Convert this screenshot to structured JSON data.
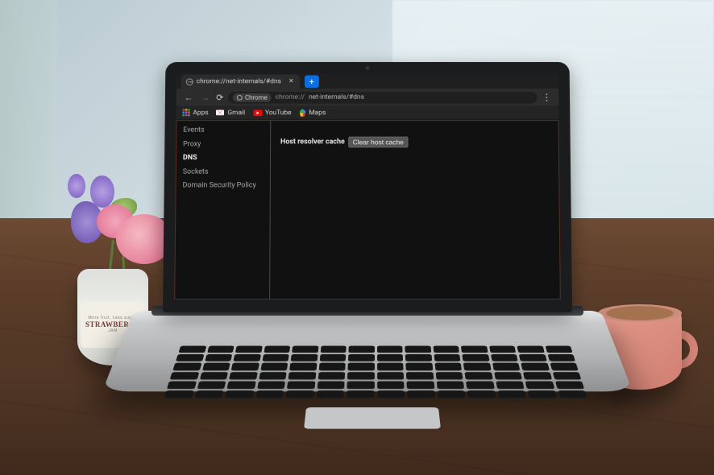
{
  "browser": {
    "tab": {
      "title": "chrome://net-internals/#dns"
    },
    "address": {
      "chip": "Chrome",
      "path_dim": "chrome://",
      "path": "net-internals/#dns"
    },
    "bookmarks": {
      "apps": "Apps",
      "gmail": "Gmail",
      "youtube": "YouTube",
      "maps": "Maps"
    }
  },
  "sidebar": {
    "items": [
      {
        "label": "Events"
      },
      {
        "label": "Proxy"
      },
      {
        "label": "DNS"
      },
      {
        "label": "Sockets"
      },
      {
        "label": "Domain Security Policy"
      }
    ],
    "active_index": 2
  },
  "main": {
    "resolver_label": "Host resolver cache",
    "clear_button": "Clear host cache"
  },
  "ambient": {
    "jar_top": "More fruit. Less sugar.",
    "jar_brand": "STRAWBERRY",
    "jar_sub": "JAM"
  }
}
